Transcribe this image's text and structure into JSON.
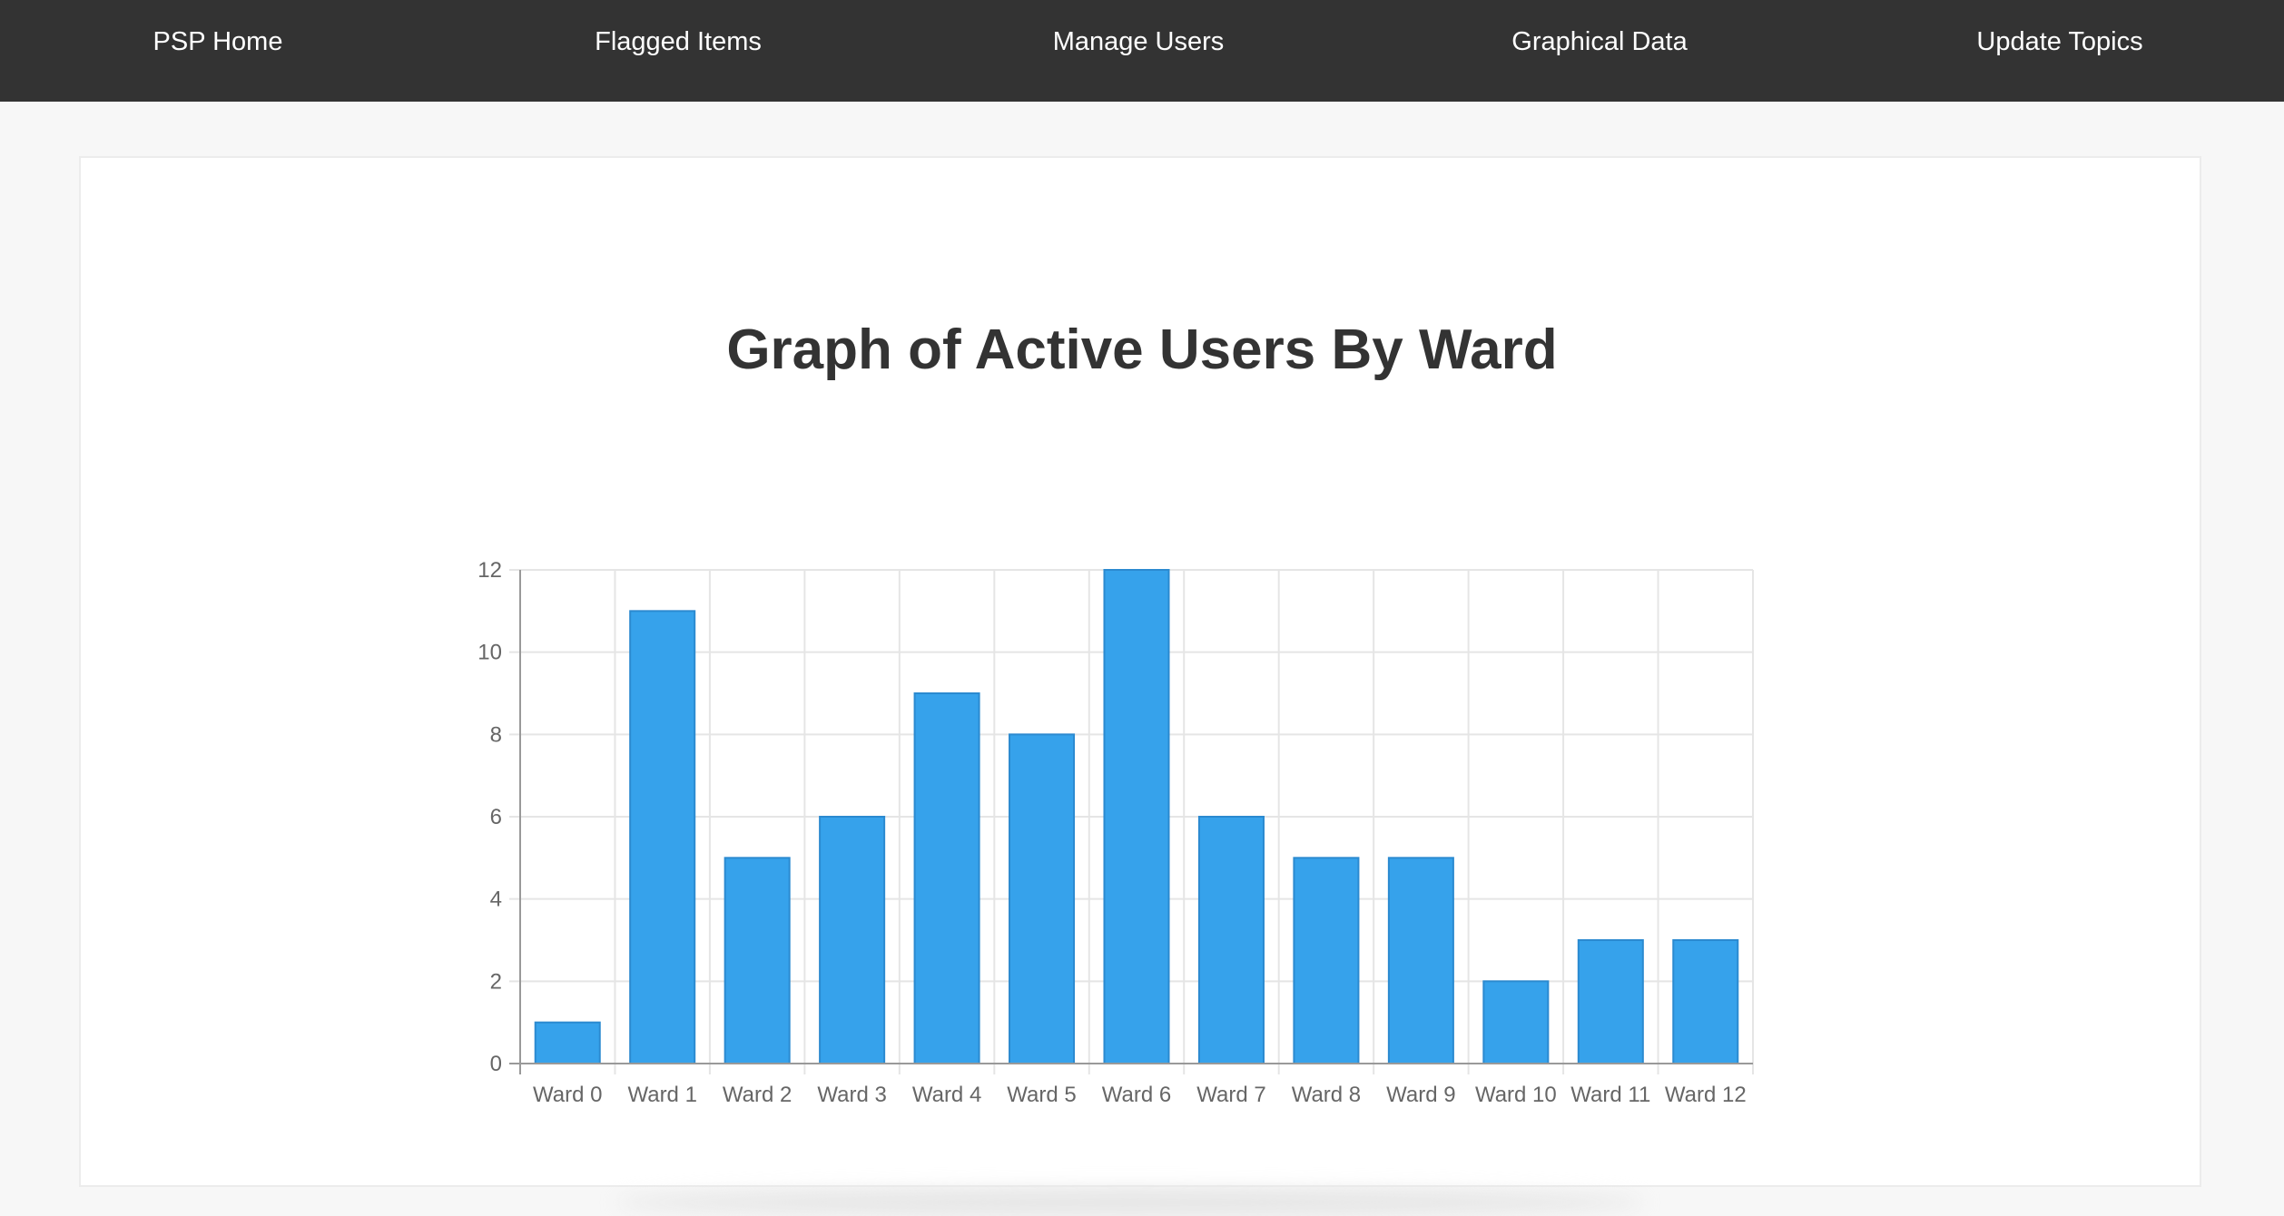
{
  "nav": {
    "items": [
      {
        "label": "PSP Home"
      },
      {
        "label": "Flagged Items"
      },
      {
        "label": "Manage Users"
      },
      {
        "label": "Graphical Data"
      },
      {
        "label": "Update Topics"
      }
    ]
  },
  "colors": {
    "navbar": "#333333",
    "bar_fill": "#36a2eb",
    "bar_border": "#2b8ad0",
    "grid": "#e5e5e5",
    "tick_text": "#666666"
  },
  "chart_data": {
    "type": "bar",
    "title": "Graph of Active Users By Ward",
    "xlabel": "",
    "ylabel": "",
    "categories": [
      "Ward 0",
      "Ward 1",
      "Ward 2",
      "Ward 3",
      "Ward 4",
      "Ward 5",
      "Ward 6",
      "Ward 7",
      "Ward 8",
      "Ward 9",
      "Ward 10",
      "Ward 11",
      "Ward 12"
    ],
    "values": [
      1,
      11,
      5,
      6,
      9,
      8,
      12,
      6,
      5,
      5,
      2,
      3,
      3
    ],
    "ylim": [
      0,
      12
    ],
    "yticks": [
      0,
      2,
      4,
      6,
      8,
      10,
      12
    ],
    "grid": true,
    "legend": "none"
  }
}
